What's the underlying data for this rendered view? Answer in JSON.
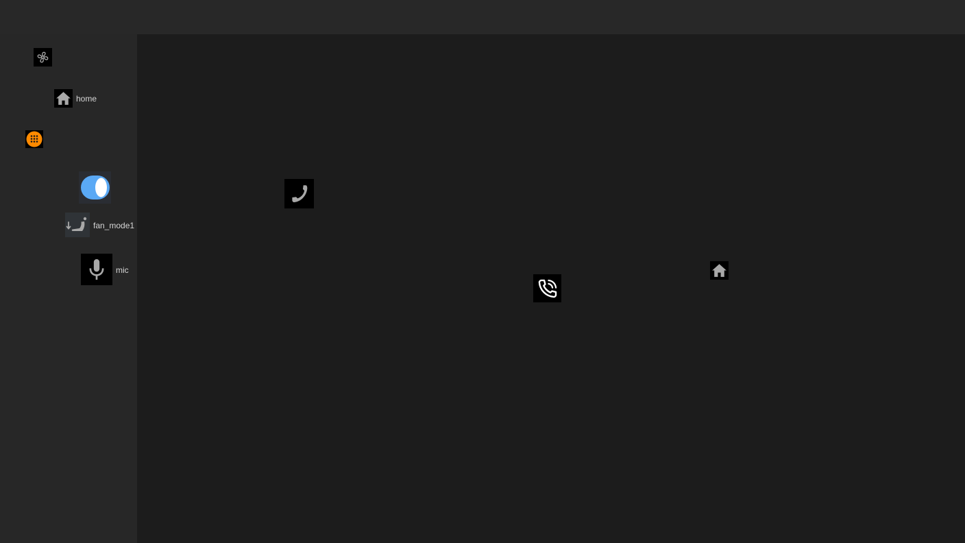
{
  "window": {
    "title": ""
  },
  "sidebar": {
    "items": [
      {
        "icon": "fan-icon",
        "label": ""
      },
      {
        "icon": "home-icon",
        "label": "home"
      },
      {
        "icon": "dialpad-icon",
        "label": "",
        "accent": "#ff8a00"
      },
      {
        "icon": "toggle-switch-icon",
        "label": "",
        "state": "on",
        "accent": "#5aa9f5"
      },
      {
        "icon": "fan-mode-seat-icon",
        "label": "fan_mode1"
      },
      {
        "icon": "mic-icon",
        "label": "mic"
      }
    ]
  },
  "main": {
    "icons": [
      {
        "icon": "phone-icon"
      },
      {
        "icon": "phone-in-talk-icon"
      },
      {
        "icon": "home-icon"
      }
    ]
  },
  "colors": {
    "background": "#1c1c1c",
    "sidebar": "#272727",
    "topbar": "#282828",
    "icon_tile": "#000000",
    "icon_glyph": "#a8a8a8",
    "text": "#d6d6d6"
  }
}
